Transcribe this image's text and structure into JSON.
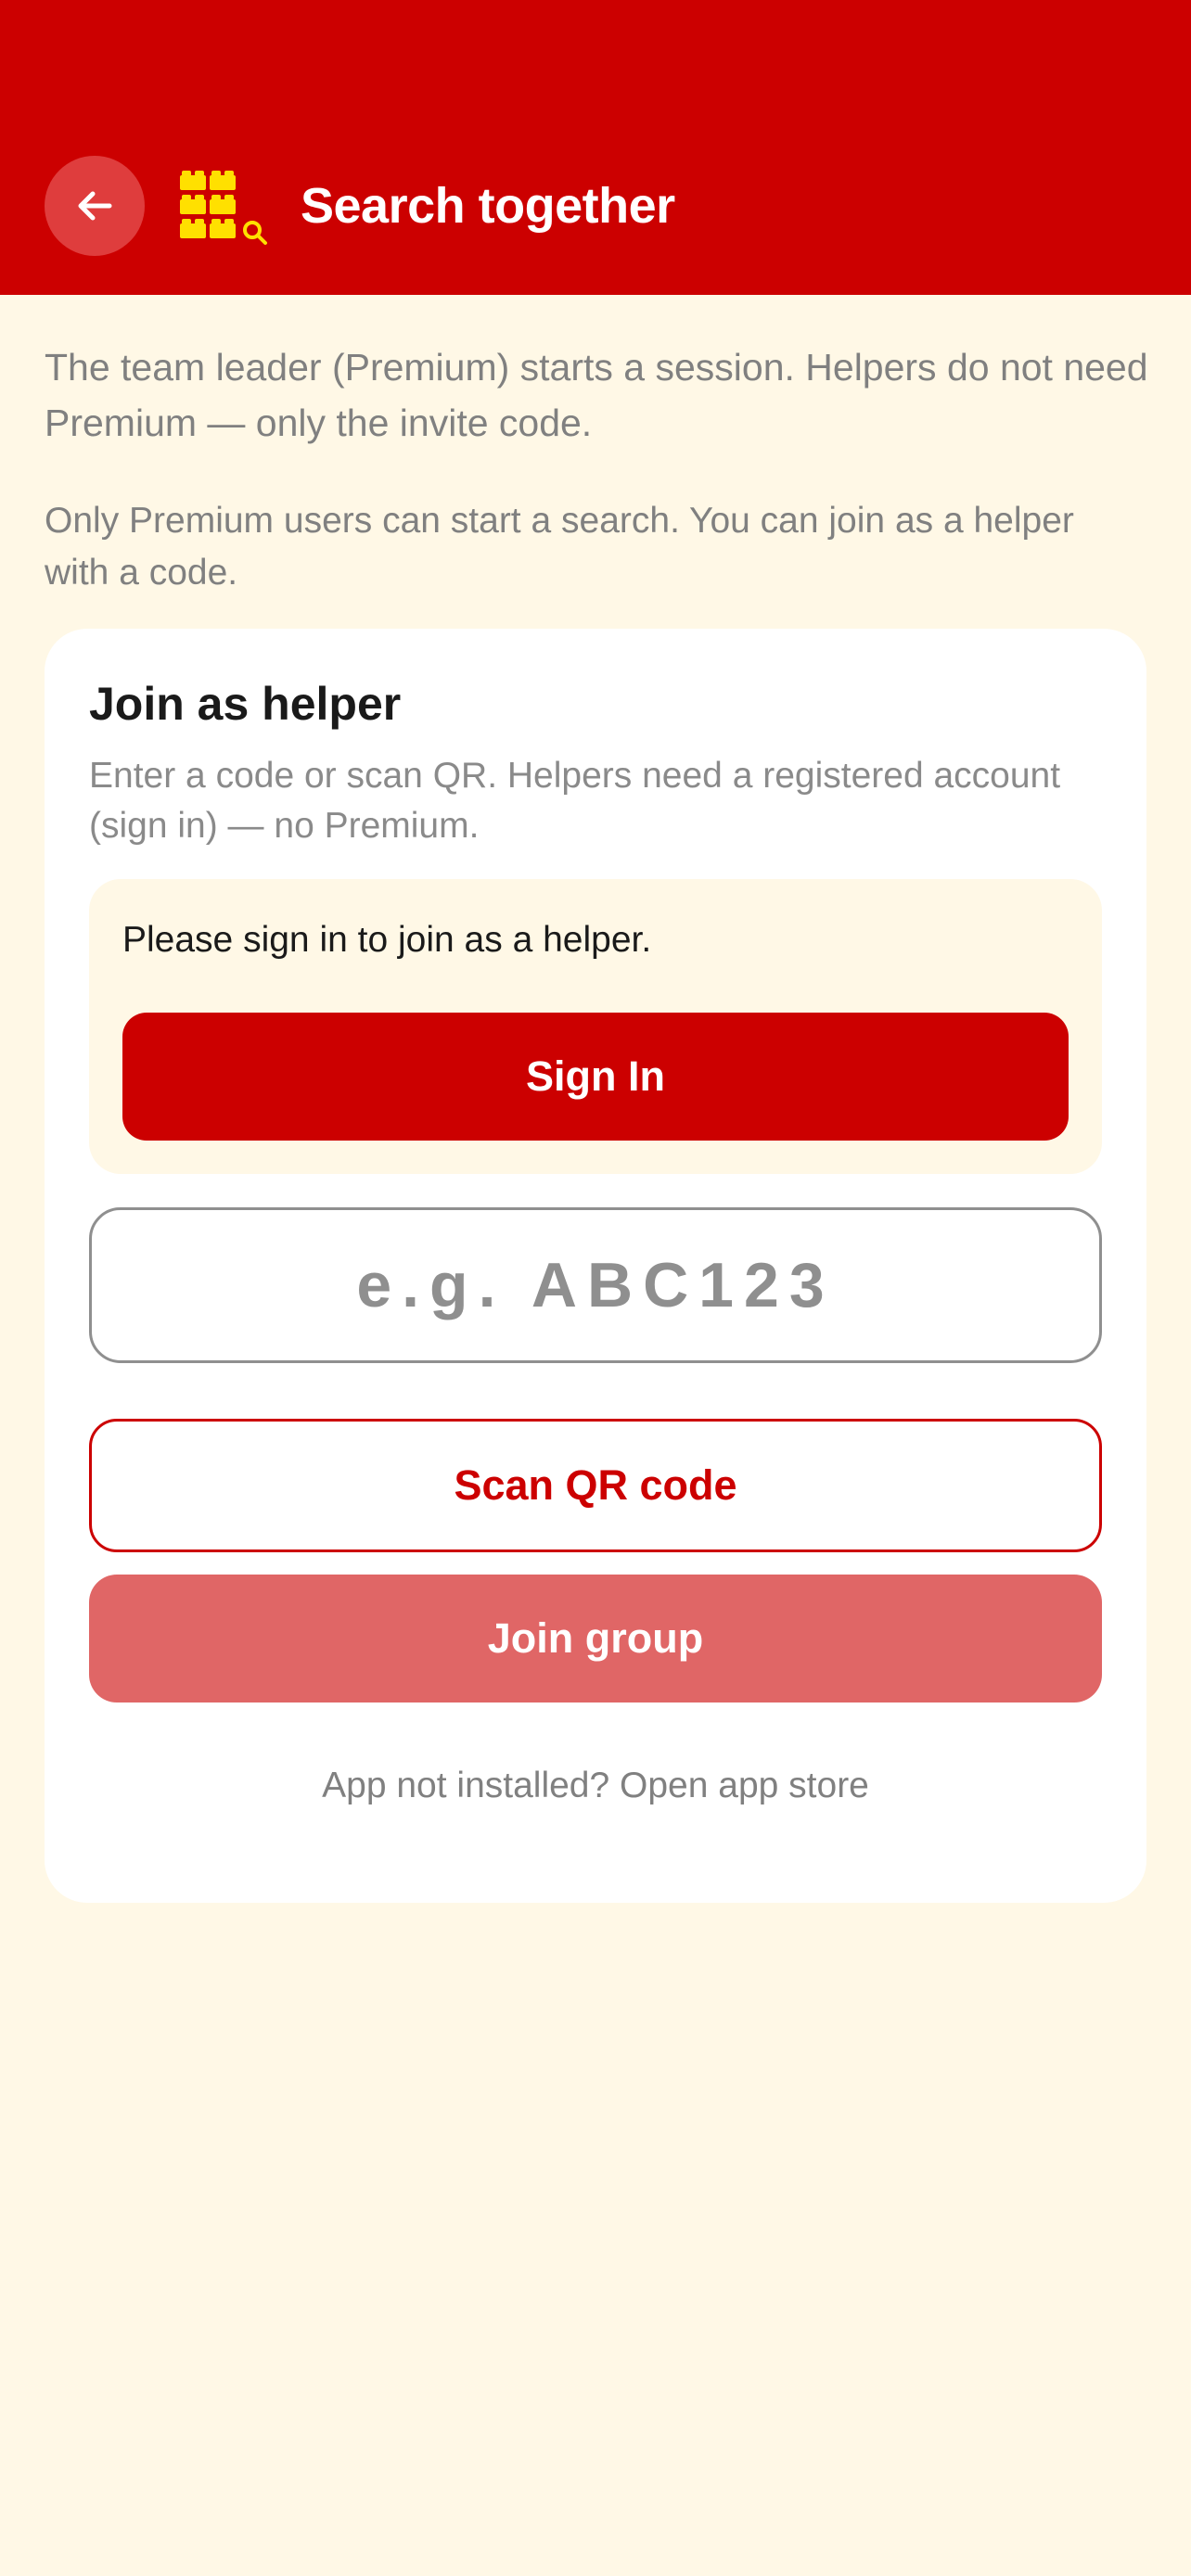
{
  "header": {
    "title": "Search together",
    "back_icon": "arrow-left-icon",
    "logo_icon": "brick-search-logo-icon",
    "colors": {
      "background": "#CC0000",
      "logo": "#FFE000"
    }
  },
  "intro": {
    "paragraph1": "The team leader (Premium) starts a session. Helpers do not need Premium — only the invite code.",
    "paragraph2": "Only Premium users can start a search. You can join as a helper with a code."
  },
  "join_card": {
    "title": "Join as helper",
    "subtitle": "Enter a code or scan QR. Helpers need a registered account (sign in) — no Premium.",
    "notice": {
      "text": "Please sign in to join as a helper.",
      "sign_in_label": "Sign In"
    },
    "code_input": {
      "value": "",
      "placeholder": "e.g. ABC123"
    },
    "scan_label": "Scan QR code",
    "join_label": "Join group",
    "store_link": "App not installed? Open app store"
  },
  "colors": {
    "accent": "#CC0000",
    "page_background": "#FFF8E6",
    "join_disabled": "#E06666"
  }
}
